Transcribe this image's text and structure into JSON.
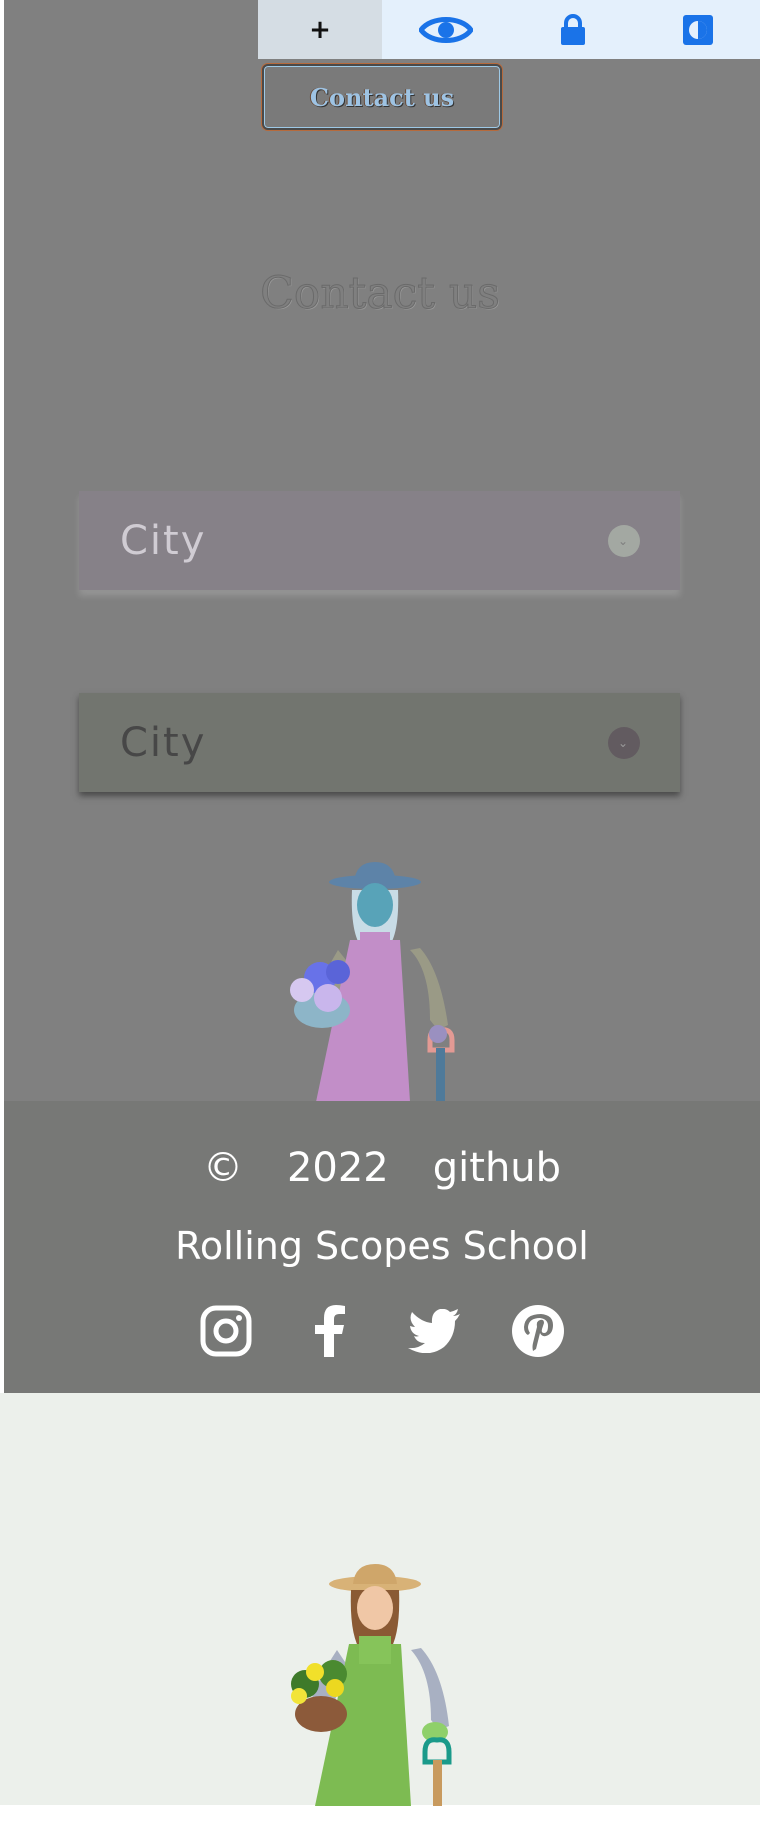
{
  "toolbar": {
    "plus_label": "+",
    "icons": [
      "eye-icon",
      "lock-icon",
      "contrast-icon"
    ],
    "accent": "#1a73e8"
  },
  "contact_button": {
    "label": "Contact us"
  },
  "contact_section": {
    "heading": "Contact us"
  },
  "city_selects": [
    {
      "selected": "City"
    },
    {
      "selected": "City"
    }
  ],
  "footer": {
    "copyright_symbol": "©",
    "year": "2022",
    "github_link": "github",
    "school_link": "Rolling Scopes School",
    "socials": [
      "instagram-icon",
      "facebook-icon",
      "twitter-icon",
      "pinterest-icon"
    ]
  },
  "colors": {
    "overlay_gray": "#808080",
    "footer_bg": "#777876",
    "light_bg": "#ecf0eb",
    "toolbar_bg": "#e4f0fc"
  }
}
